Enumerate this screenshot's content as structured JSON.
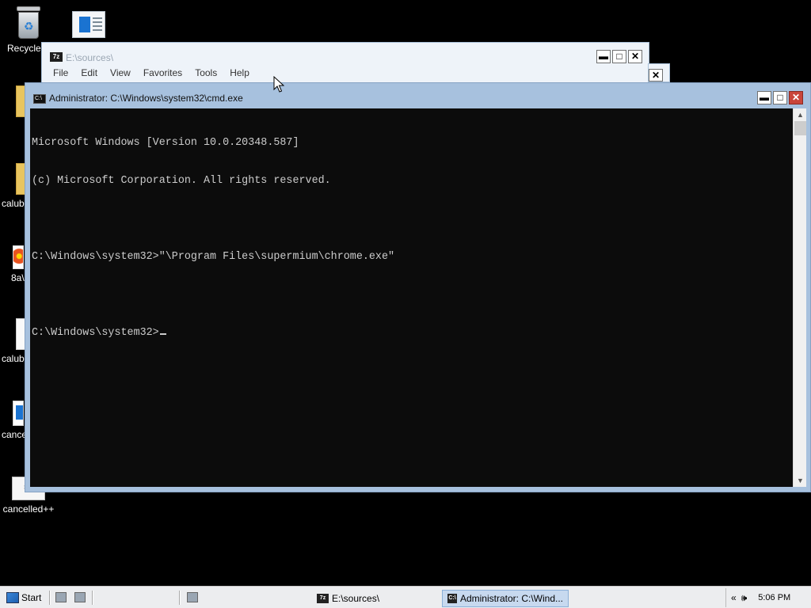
{
  "desktop": {
    "icons": [
      {
        "label": "Recycle B"
      },
      {
        "label": ""
      },
      {
        "label": "calub"
      },
      {
        "label": "8a\\"
      },
      {
        "label": "calub"
      },
      {
        "label": "cance"
      },
      {
        "label": "cancelled++"
      }
    ]
  },
  "sevenzip": {
    "title": "E:\\sources\\",
    "app_icon": "7z",
    "menu": [
      "File",
      "Edit",
      "View",
      "Favorites",
      "Tools",
      "Help"
    ],
    "buttons": {
      "minimize": "▬",
      "maximize": "□",
      "close": "✕"
    }
  },
  "cmd": {
    "title": "Administrator: C:\\Windows\\system32\\cmd.exe",
    "app_icon": "C:\\",
    "buttons": {
      "minimize": "▬",
      "maximize": "□",
      "close": "✕"
    },
    "lines": [
      "Microsoft Windows [Version 10.0.20348.587]",
      "(c) Microsoft Corporation. All rights reserved.",
      "",
      "C:\\Windows\\system32>\"\\Program Files\\supermium\\chrome.exe\"",
      "",
      "C:\\Windows\\system32>"
    ]
  },
  "taskbar": {
    "start_label": "Start",
    "tasks": [
      {
        "label": "E:\\sources\\",
        "icon": "7z"
      },
      {
        "label": "Administrator: C:\\Wind...",
        "icon": "C:\\"
      }
    ],
    "tray_chevron": "«",
    "volume_icon": "🕪",
    "clock": "5:06 PM"
  },
  "colors": {
    "console_bg": "#0c0c0c",
    "console_fg": "#cccccc",
    "cmd_frame": "#a7c1de",
    "close_button": "#c9453a",
    "desktop_bg": "#000000"
  }
}
